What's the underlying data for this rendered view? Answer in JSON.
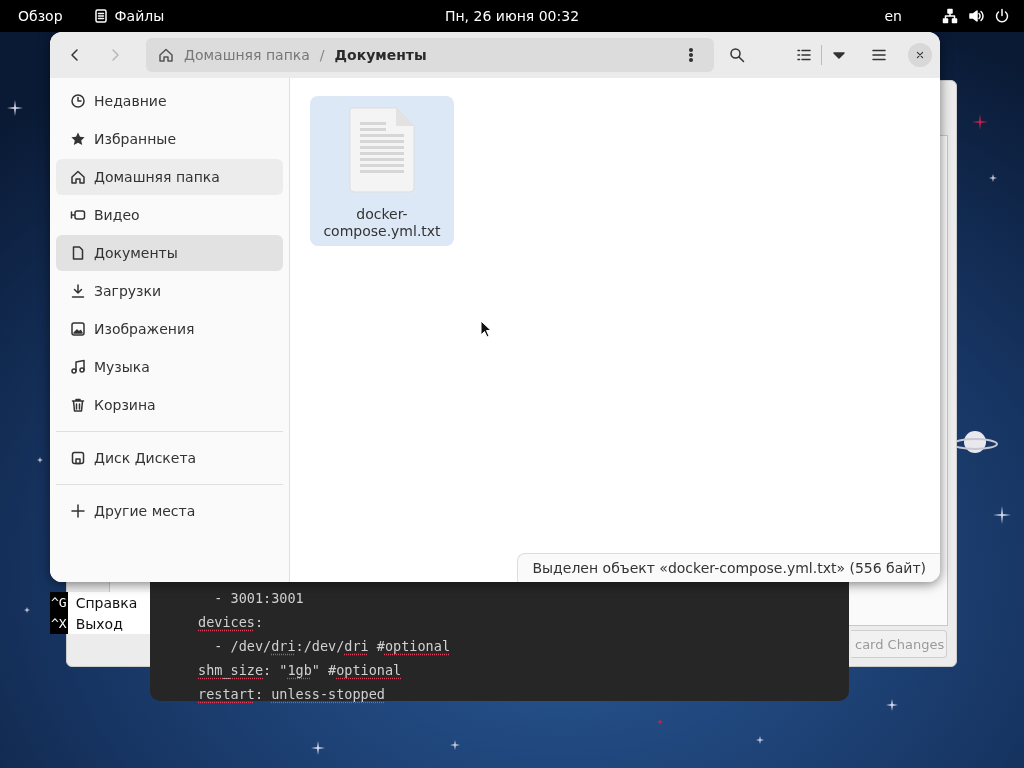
{
  "top_bar": {
    "activities": "Обзор",
    "app": "Файлы",
    "clock": "Пн, 26 июня  00:32",
    "language": "en"
  },
  "background_window": {
    "button": "card Changes"
  },
  "nano_help": [
    {
      "key": "^G",
      "label": "Справка"
    },
    {
      "key": "^X",
      "label": "Выход"
    }
  ],
  "terminal": {
    "lines": [
      [
        {
          "text": "  - 3001:3001",
          "misspelled": false
        }
      ],
      [
        {
          "text": "devices",
          "misspelled": true
        },
        {
          "text": ":",
          "misspelled": false
        }
      ],
      [
        {
          "text": "  - /dev/",
          "misspelled": false
        },
        {
          "text": "dri",
          "misspelled": true
        },
        {
          "text": ":/dev/",
          "misspelled": false
        },
        {
          "text": "dri",
          "misspelled": true
        },
        {
          "text": " #",
          "misspelled": false
        },
        {
          "text": "optional",
          "misspelled": true
        }
      ],
      [
        {
          "text": "shm_size",
          "misspelled": true
        },
        {
          "text": ": \"",
          "misspelled": false
        },
        {
          "text": "1gb",
          "misspelled": true
        },
        {
          "text": "\" #",
          "misspelled": false
        },
        {
          "text": "optional",
          "misspelled": true
        }
      ],
      [
        {
          "text": "restart",
          "misspelled": true
        },
        {
          "text": ": ",
          "misspelled": false
        },
        {
          "text": "unless-stopped",
          "misspelled": true
        }
      ]
    ]
  },
  "files_window": {
    "path": [
      {
        "label": "Домашняя папка",
        "selected": false
      },
      {
        "separator": "/",
        "label": "Документы",
        "selected": true
      }
    ],
    "sidebar": {
      "sections": [
        [
          {
            "label": "Недавние",
            "selected": false,
            "hovered": false
          },
          {
            "label": "Избранные",
            "selected": false,
            "hovered": false
          },
          {
            "label": "Домашняя папка",
            "selected": false,
            "hovered": true
          },
          {
            "label": "Видео",
            "selected": false,
            "hovered": false
          },
          {
            "label": "Документы",
            "selected": true,
            "hovered": false
          },
          {
            "label": "Загрузки",
            "selected": false,
            "hovered": false
          },
          {
            "label": "Изображения",
            "selected": false,
            "hovered": false
          },
          {
            "label": "Музыка",
            "selected": false,
            "hovered": false
          },
          {
            "label": "Корзина",
            "selected": false,
            "hovered": false
          }
        ],
        [
          {
            "label": "Диск Дискета",
            "selected": false,
            "hovered": false
          }
        ],
        [
          {
            "label": "Другие места",
            "selected": false,
            "hovered": false
          }
        ]
      ]
    },
    "files": [
      {
        "name": "docker-\ncompose.yml.txt",
        "selected": true
      }
    ],
    "status": "Выделен объект «docker-compose.yml.txt»  (556 байт)"
  }
}
